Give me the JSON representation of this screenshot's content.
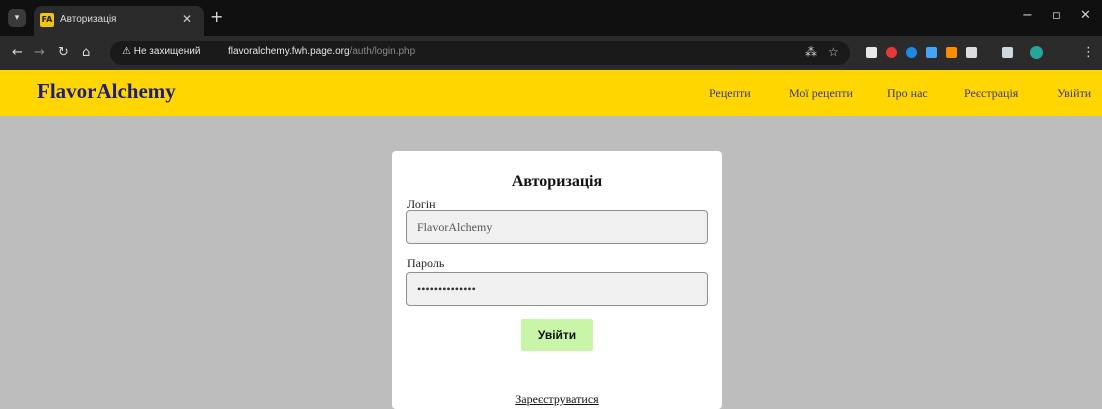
{
  "browser": {
    "tab_title": "Авторизація",
    "favicon_text": "FA",
    "security_warning": "Не захищений",
    "url_host": "flavoralchemy.fwh.page.org",
    "url_path": "/auth/login.php",
    "win_minimize": "−",
    "win_maximize": "▫",
    "win_close": "✕"
  },
  "header": {
    "logo": "FlavorAlchemy",
    "nav": [
      "Рецепти",
      "Мої рецепти",
      "Про нас",
      "Реєстрація",
      "Увійти"
    ]
  },
  "login": {
    "title": "Авторизація",
    "login_label": "Логін",
    "login_value": "FlavorAlchemy",
    "password_label": "Пароль",
    "password_value": "••••••••••••••",
    "submit": "Увійти",
    "register": "Зареєструватися"
  },
  "colors": {
    "header_bg": "#ffd600",
    "logo": "#1f1f7a",
    "button_bg": "#c8f5a7",
    "page_bg": "#bdbdbd"
  }
}
